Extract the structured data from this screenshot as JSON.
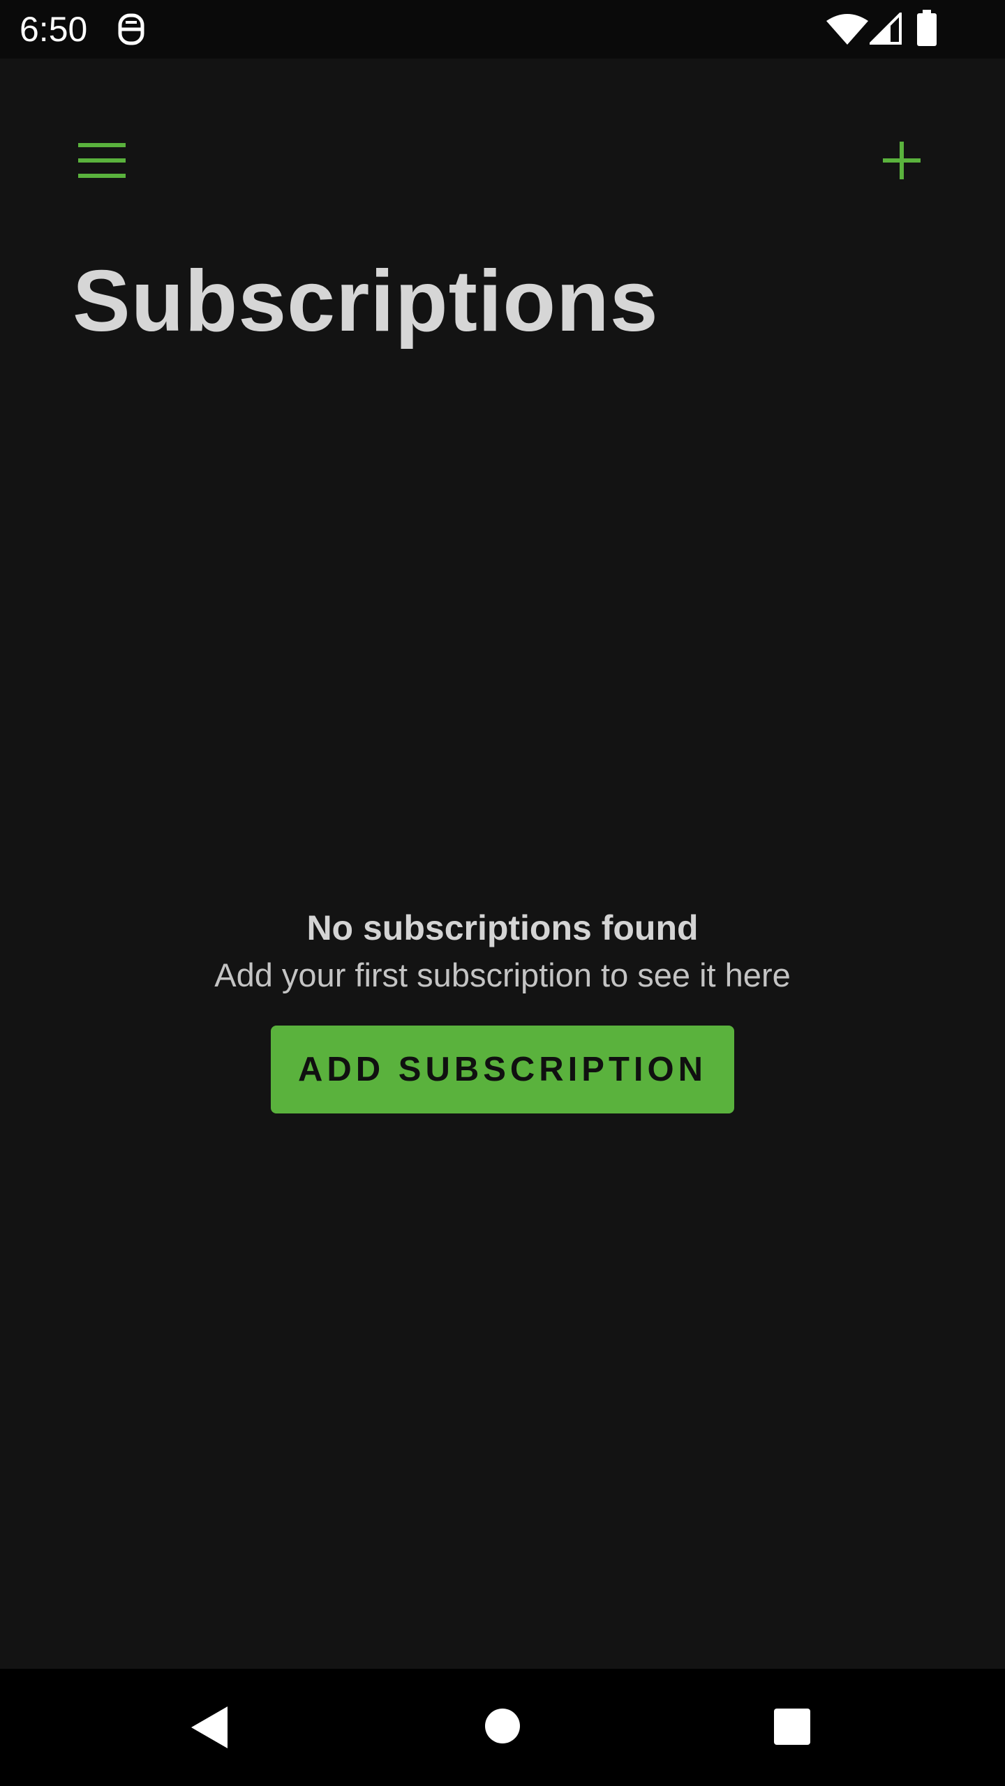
{
  "status_bar": {
    "time": "6:50",
    "app_icon": "sim-toolkit-icon",
    "icons": [
      "wifi-icon",
      "cell-signal-icon",
      "battery-icon"
    ]
  },
  "app_bar": {
    "menu_icon": "hamburger-menu-icon",
    "add_icon": "plus-icon"
  },
  "page": {
    "title": "Subscriptions"
  },
  "empty_state": {
    "title": "No subscriptions found",
    "subtitle": "Add your first subscription to see it here",
    "button_label": "ADD SUBSCRIPTION"
  },
  "nav_bar": {
    "icons": [
      "back-icon",
      "home-icon",
      "recents-icon"
    ]
  },
  "colors": {
    "background": "#131313",
    "accent": "#5ab23d",
    "title_text": "#d6d6d6",
    "status_bar": "#0a0a0a",
    "nav_bar": "#000000"
  }
}
